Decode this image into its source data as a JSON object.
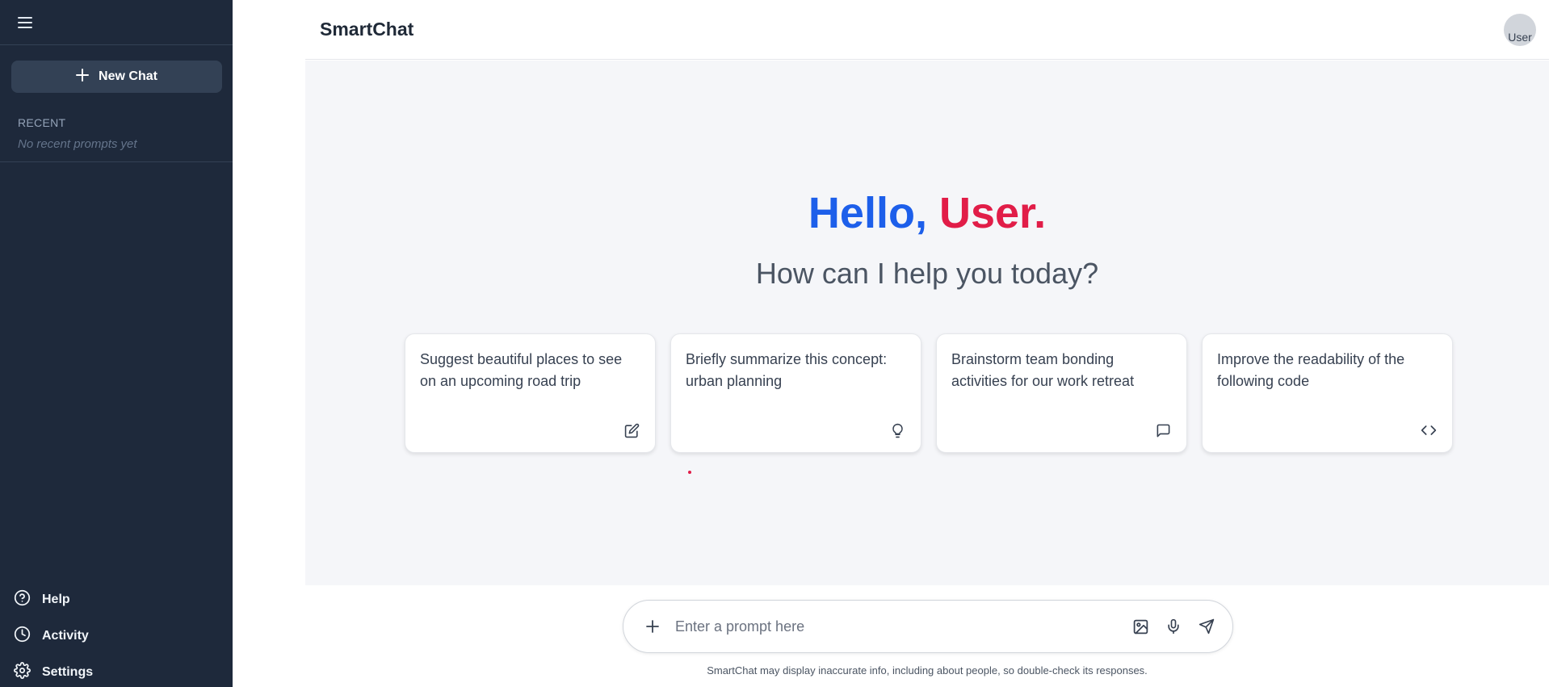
{
  "sidebar": {
    "menu_icon": "hamburger-menu-icon",
    "new_chat": {
      "label": "New Chat",
      "icon": "plus-icon"
    },
    "recent": {
      "title": "RECENT",
      "empty_text": "No recent prompts yet"
    },
    "bottom_links": [
      {
        "label": "Help",
        "icon": "help-circle-icon"
      },
      {
        "label": "Activity",
        "icon": "clock-icon"
      },
      {
        "label": "Settings",
        "icon": "gear-icon"
      }
    ]
  },
  "header": {
    "title": "SmartChat",
    "avatar_alt": "User"
  },
  "greeting": {
    "hello": "Hello,",
    "name": "User.",
    "subtitle": "How can I help you today?",
    "colors": {
      "hello": "#1d5fea",
      "name": "#e11d48"
    }
  },
  "suggestions": [
    {
      "text": "Suggest beautiful places to see on an upcoming road trip",
      "icon": "edit-icon"
    },
    {
      "text": "Briefly summarize this concept: urban planning",
      "icon": "lightbulb-icon"
    },
    {
      "text": "Brainstorm team bonding activities for our work retreat",
      "icon": "message-icon"
    },
    {
      "text": "Improve the readability of the following code",
      "icon": "code-icon"
    }
  ],
  "input": {
    "placeholder": "Enter a prompt here",
    "value": "",
    "icons": [
      "plus-icon",
      "image-icon",
      "microphone-icon",
      "send-icon"
    ]
  },
  "footer": {
    "disclaimer": "SmartChat may display inaccurate info, including about people, so double-check its responses."
  },
  "theme": {
    "sidebar_bg": "#1e293b",
    "content_bg": "#f5f6f9"
  }
}
